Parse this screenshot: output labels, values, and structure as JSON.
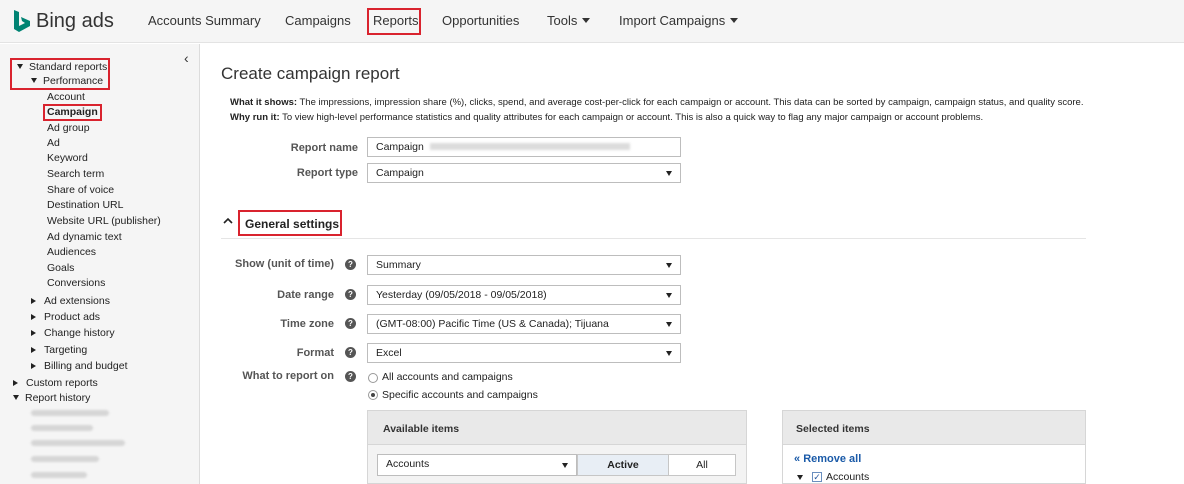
{
  "brand": {
    "name": "Bing ads",
    "logo_icon": "bing-logo-icon",
    "accent": "#008373"
  },
  "topnav": {
    "items": [
      {
        "label": "Accounts Summary"
      },
      {
        "label": "Campaigns"
      },
      {
        "label": "Reports",
        "active": true
      },
      {
        "label": "Opportunities"
      },
      {
        "label": "Tools",
        "dropdown": true
      },
      {
        "label": "Import Campaigns",
        "dropdown": true
      }
    ]
  },
  "sidebar": {
    "collapse_icon": "chevron-left-icon",
    "standard_reports": "Standard reports",
    "performance": "Performance",
    "performance_items": [
      "Account",
      "Campaign",
      "Ad group",
      "Ad",
      "Keyword",
      "Search term",
      "Share of voice",
      "Destination URL",
      "Website URL (publisher)",
      "Ad dynamic text",
      "Audiences",
      "Goals",
      "Conversions"
    ],
    "groups": [
      "Ad extensions",
      "Product ads",
      "Change history",
      "Targeting",
      "Billing and budget"
    ],
    "custom_reports": "Custom reports",
    "report_history": "Report history"
  },
  "main": {
    "title": "Create campaign report",
    "what_label": "What it shows:",
    "what_text": " The impressions, impression share (%), clicks, spend, and average cost-per-click for each campaign or account. This data can be sorted by campaign, campaign status, and quality score.",
    "why_label": "Why run it:",
    "why_text": " To view high-level performance statistics and quality attributes for each campaign or account. This is also a quick way to flag any major campaign or account problems.",
    "report_name_label": "Report name",
    "report_name_value": "Campaign",
    "report_type_label": "Report type",
    "report_type_value": "Campaign",
    "general_settings": "General settings",
    "show_label": "Show (unit of time)",
    "show_value": "Summary",
    "date_range_label": "Date range",
    "date_range_value": "Yesterday (09/05/2018 - 09/05/2018)",
    "time_zone_label": "Time zone",
    "time_zone_value": "(GMT-08:00) Pacific Time (US & Canada); Tijuana",
    "format_label": "Format",
    "format_value": "Excel",
    "report_on_label": "What to report on",
    "radio_all": "All accounts and campaigns",
    "radio_specific": "Specific accounts and campaigns",
    "available_items": "Available items",
    "accounts_select": "Accounts",
    "seg_active": "Active",
    "seg_all": "All",
    "selected_items": "Selected items",
    "remove_all": "Remove all",
    "selected_accounts": "Accounts"
  }
}
